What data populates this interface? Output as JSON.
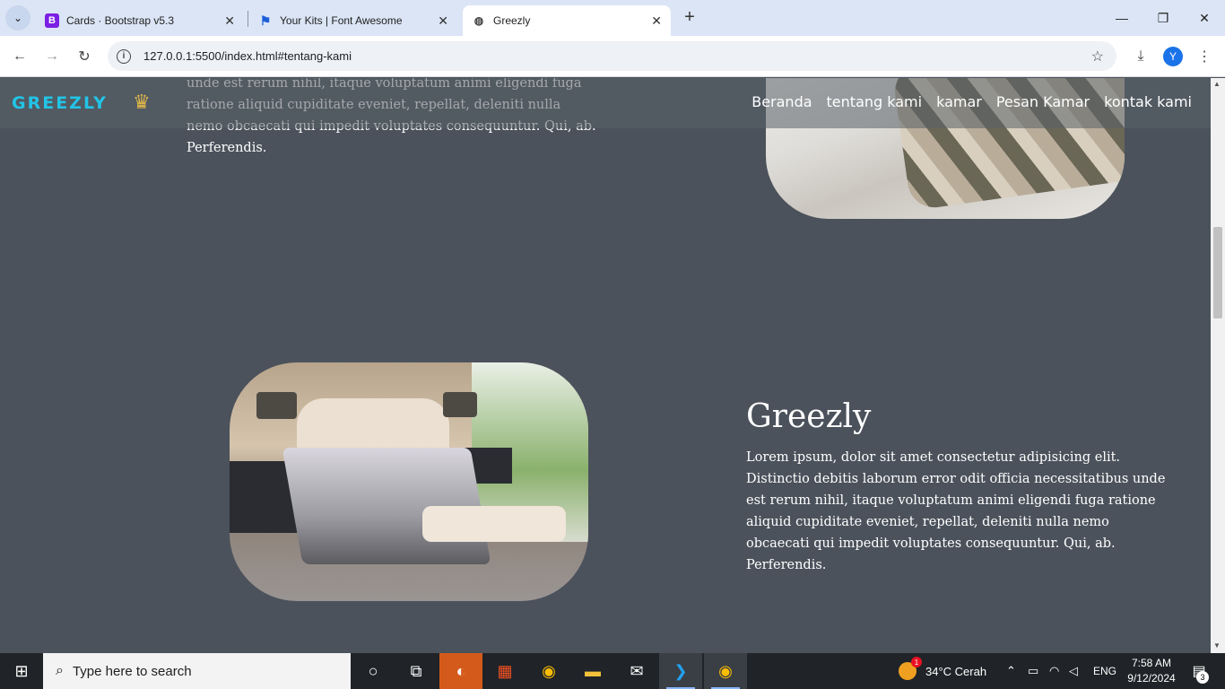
{
  "browser": {
    "tabs": [
      {
        "title": "Cards · Bootstrap v5.3",
        "favicon": "B"
      },
      {
        "title": "Your Kits | Font Awesome",
        "favicon": "⚑"
      },
      {
        "title": "Greezly",
        "favicon": "🌐"
      }
    ],
    "url": "127.0.0.1:5500/index.html#tentang-kami",
    "profile_initial": "Y"
  },
  "site": {
    "brand": "GREEZLY",
    "nav": [
      "Beranda",
      "tentang kami",
      "kamar",
      "Pesan Kamar",
      "kontak kami"
    ],
    "prev_section_text": "unde est rerum nihil, itaque voluptatum animi eligendi fuga ratione aliquid cupiditate eveniet, repellat, deleniti nulla nemo obcaecati qui impedit voluptates consequuntur. Qui, ab. Perferendis.",
    "section": {
      "title": "Greezly",
      "body": "Lorem ipsum, dolor sit amet consectetur adipisicing elit. Distinctio debitis laborum error odit officia necessitatibus unde est rerum nihil, itaque voluptatum animi eligendi fuga ratione aliquid cupiditate eveniet, repellat, deleniti nulla nemo obcaecati qui impedit voluptates consequuntur. Qui, ab. Perferendis."
    }
  },
  "taskbar": {
    "search_placeholder": "Type here to search",
    "weather": "34°C  Cerah",
    "weather_badge": "1",
    "language": "ENG",
    "time": "7:58 AM",
    "date": "9/12/2024",
    "notification_count": "3"
  }
}
